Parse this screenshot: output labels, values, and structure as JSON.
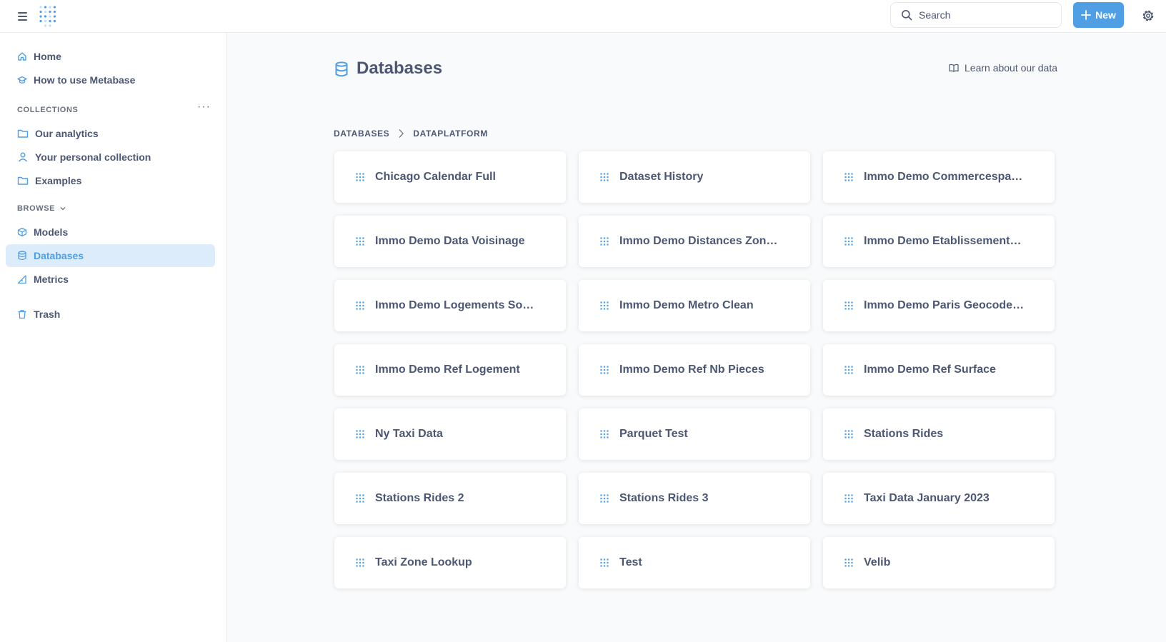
{
  "colors": {
    "accent": "#509ee3",
    "active_bg": "#ddecfa",
    "text": "#4c5773",
    "muted": "#696e7b",
    "page_bg": "#f9fafb"
  },
  "topbar": {
    "menu_icon": "hamburger-icon",
    "logo_icon": "metabase-logo",
    "search": {
      "placeholder": "Search",
      "icon": "search-icon"
    },
    "new_button": {
      "label": "New",
      "icon": "plus-icon"
    },
    "settings_icon": "gear-icon"
  },
  "sidebar": {
    "top_items": [
      {
        "label": "Home",
        "icon": "home-icon"
      },
      {
        "label": "How to use Metabase",
        "icon": "learn-icon"
      }
    ],
    "collections_label": "COLLECTIONS",
    "collections": [
      {
        "label": "Our analytics",
        "icon": "folder-icon"
      },
      {
        "label": "Your personal collection",
        "icon": "person-icon"
      },
      {
        "label": "Examples",
        "icon": "folder-icon"
      }
    ],
    "browse_label": "BROWSE",
    "browse": [
      {
        "label": "Models",
        "icon": "model-icon"
      },
      {
        "label": "Databases",
        "icon": "database-icon",
        "active": true
      },
      {
        "label": "Metrics",
        "icon": "metric-icon"
      }
    ],
    "trash": {
      "label": "Trash",
      "icon": "trash-icon"
    }
  },
  "main": {
    "title": "Databases",
    "title_icon": "database-icon",
    "learn_link": "Learn about our data",
    "breadcrumb": [
      "DATABASES",
      "DATAPLATFORM"
    ],
    "tables": [
      "Chicago Calendar Full",
      "Dataset History",
      "Immo Demo Commercespa…",
      "Immo Demo Data Voisinage",
      "Immo Demo Distances Zon…",
      "Immo Demo Etablissement…",
      "Immo Demo Logements So…",
      "Immo Demo Metro Clean",
      "Immo Demo Paris Geocode…",
      "Immo Demo Ref Logement",
      "Immo Demo Ref Nb Pieces",
      "Immo Demo Ref Surface",
      "Ny Taxi Data",
      "Parquet Test",
      "Stations Rides",
      "Stations Rides 2",
      "Stations Rides 3",
      "Taxi Data January 2023",
      "Taxi Zone Lookup",
      "Test",
      "Velib"
    ]
  }
}
